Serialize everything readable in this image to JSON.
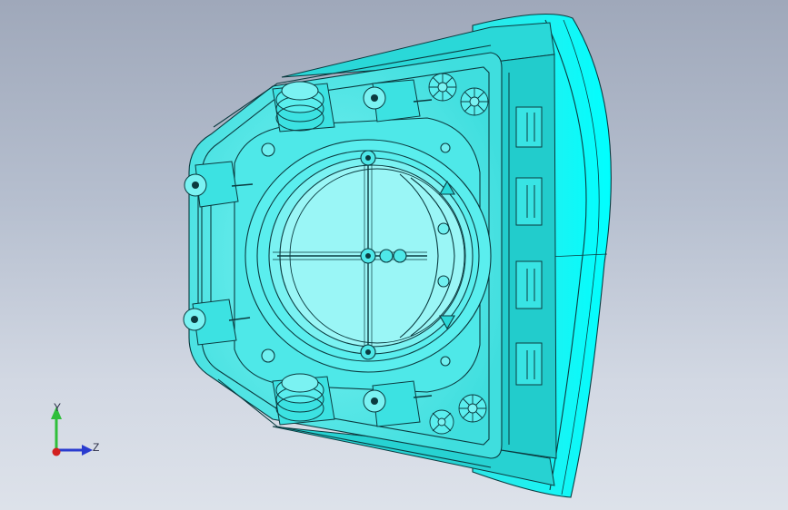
{
  "viewport": {
    "background_top": "#9fa8ba",
    "background_bottom": "#dde2ea",
    "model_color": "#00ffff",
    "edge_color": "#0b3b40"
  },
  "triad": {
    "y_label": "Y",
    "z_label": "Z",
    "y_axis_color": "#2fbf3a",
    "z_axis_color": "#2a3ccf",
    "x_axis_color": "#d22020"
  }
}
